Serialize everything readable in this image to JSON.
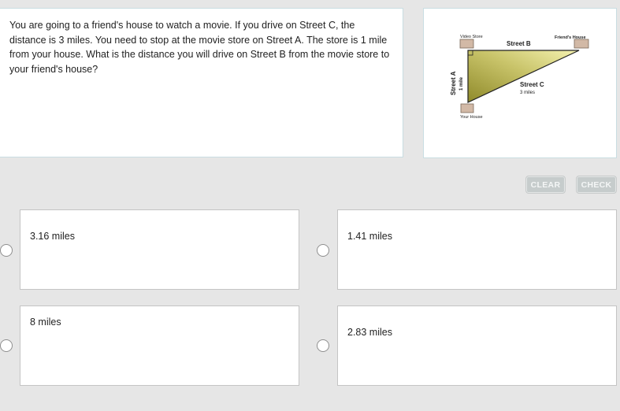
{
  "question": {
    "text": "You are going to a friend's house to watch a movie. If you drive on Street C, the distance is 3 miles. You need to stop at the movie store on Street A. The store is 1 mile from your house. What is the distance you will drive on Street B from the movie store to your friend's house?"
  },
  "figure": {
    "video_store_label": "Video Store",
    "friends_house_label": "Friend's House",
    "your_house_label": "Your House",
    "street_b_label": "Street B",
    "street_c_label": "Street C",
    "street_c_distance": "3 miles",
    "street_a_label": "Street A",
    "street_a_distance": "1 mile",
    "colors": {
      "triangle_light": "#f2f0a0",
      "triangle_dark": "#8f8a2a",
      "building": "#d2b9a6"
    }
  },
  "buttons": {
    "clear": "CLEAR",
    "check": "CHECK"
  },
  "options": [
    {
      "label": "3.16 miles"
    },
    {
      "label": "1.41 miles"
    },
    {
      "label": "8 miles"
    },
    {
      "label": "2.83 miles"
    }
  ]
}
